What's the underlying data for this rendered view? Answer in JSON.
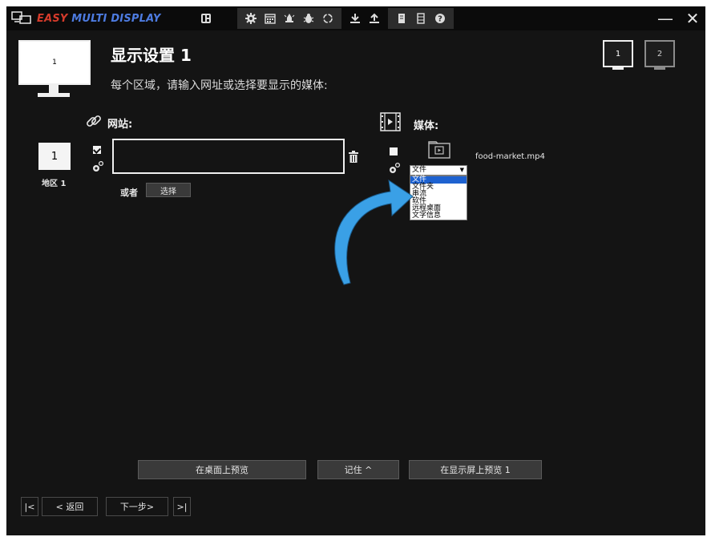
{
  "app": {
    "brand_easy": "EASY",
    "brand_rest": "MULTI DISPLAY",
    "colors": {
      "background": "#141414",
      "titlebar": "#0b0b0b",
      "brand_red": "#d53b2b",
      "brand_blue": "#4d7be0",
      "selection_blue": "#1e62d0",
      "arrow_blue": "#3aa0e6"
    }
  },
  "toolbar": {
    "icons": [
      "layout-icon",
      "gear-icon",
      "calendar-icon",
      "alert-icon",
      "bug-icon",
      "refresh-icon",
      "download-icon",
      "upload-icon",
      "note-icon",
      "film-icon",
      "help-icon"
    ]
  },
  "window": {
    "minimize": "—",
    "close": "✕"
  },
  "header": {
    "monitor_number": "1",
    "title": "显示设置 1",
    "subtitle": "每个区域，请输入网址或选择要显示的媒体:"
  },
  "display_switch": {
    "display1": "1",
    "display2": "2"
  },
  "website": {
    "label": "网站:",
    "url_value": "",
    "or_label": "或者",
    "select_label": "选择"
  },
  "zone": {
    "number": "1",
    "label": "地区 1"
  },
  "media": {
    "label": "媒体:",
    "type_value": "文件",
    "options": [
      "文件",
      "文件夹",
      "串流",
      "软件",
      "远程桌面",
      "文字信息"
    ],
    "selected_index": 0,
    "filename": "food-market.mp4"
  },
  "footer": {
    "preview_desktop": "在桌面上预览",
    "remember": "记住 ^",
    "preview_screen": "在显示屏上预览 1",
    "first": "|<",
    "back": "< 返回",
    "next": "下一步>",
    "last": ">|"
  }
}
